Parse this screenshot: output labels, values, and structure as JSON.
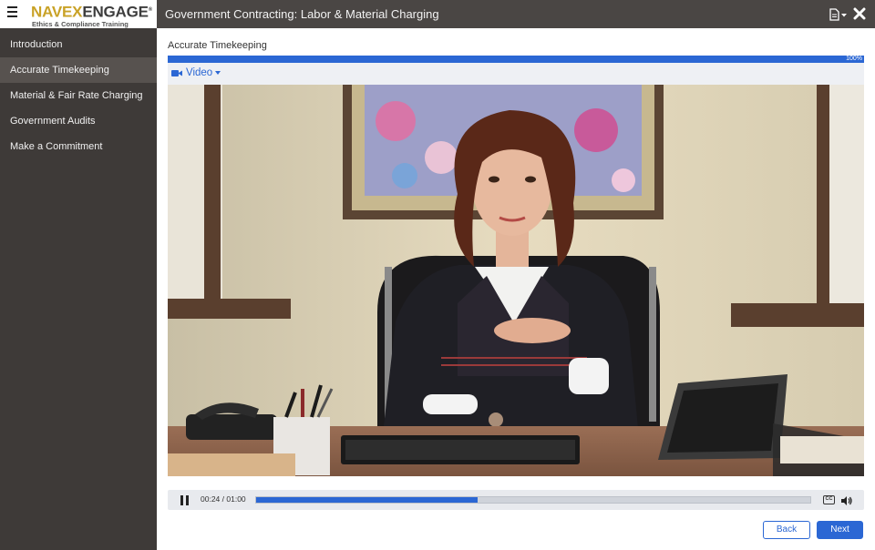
{
  "brand": {
    "logo_part1": "NAVEX",
    "logo_part2": "ENGAGE",
    "logo_mark": "®",
    "tagline": "Ethics & Compliance Training",
    "menu_icon": "hamburger-icon"
  },
  "header": {
    "course_title": "Government Contracting: Labor & Material Charging",
    "document_menu_icon": "document-icon",
    "close_icon": "close-icon"
  },
  "sidebar": {
    "items": [
      {
        "label": "Introduction",
        "active": false
      },
      {
        "label": "Accurate Timekeeping",
        "active": true
      },
      {
        "label": "Material & Fair Rate Charging",
        "active": false
      },
      {
        "label": "Government Audits",
        "active": false
      },
      {
        "label": "Make a Commitment",
        "active": false
      }
    ]
  },
  "main": {
    "page_title": "Accurate Timekeeping",
    "progress_percent": 100,
    "progress_label": "100%",
    "media_toggle_label": "Video",
    "media_icon": "video-camera-icon"
  },
  "player": {
    "state": "playing",
    "current_time": "00:24",
    "separator": " / ",
    "duration": "01:00",
    "played_fraction": 0.4,
    "captions_label": "CC",
    "volume_icon": "volume-icon"
  },
  "footer": {
    "back_label": "Back",
    "next_label": "Next"
  },
  "colors": {
    "accent": "#2b67d4",
    "header_bg": "#4a4644",
    "sidebar_bg": "#3e3a38",
    "sidebar_active_bg": "#57524f",
    "logo_gold": "#c9a227"
  }
}
